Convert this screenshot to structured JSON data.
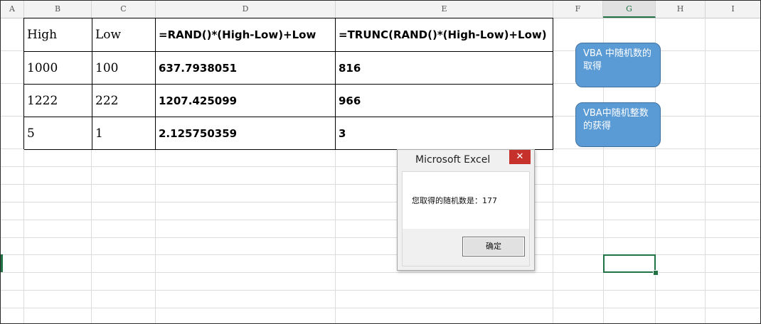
{
  "columns": [
    "A",
    "B",
    "C",
    "D",
    "E",
    "F",
    "G",
    "H",
    "I"
  ],
  "selected_column": "G",
  "table": {
    "headers": [
      "High",
      "Low",
      "=RAND()*(High-Low)+Low",
      "=TRUNC(RAND()*(High-Low)+Low)"
    ],
    "rows": [
      [
        "1000",
        "100",
        "637.7938051",
        "816"
      ],
      [
        "1222",
        "222",
        "1207.425099",
        "966"
      ],
      [
        "5",
        "1",
        "2.125750359",
        "3"
      ]
    ]
  },
  "shapes": [
    {
      "label": "VBA 中随机数的取得"
    },
    {
      "label": "VBA中随机整数的获得"
    }
  ],
  "dialog": {
    "title": "Microsoft Excel",
    "close_glyph": "✕",
    "message": "您取得的随机数是：177",
    "ok_label": "确定"
  },
  "colors": {
    "accent": "#217346",
    "shape_fill": "#5b9bd5",
    "close_red": "#c7312c"
  }
}
